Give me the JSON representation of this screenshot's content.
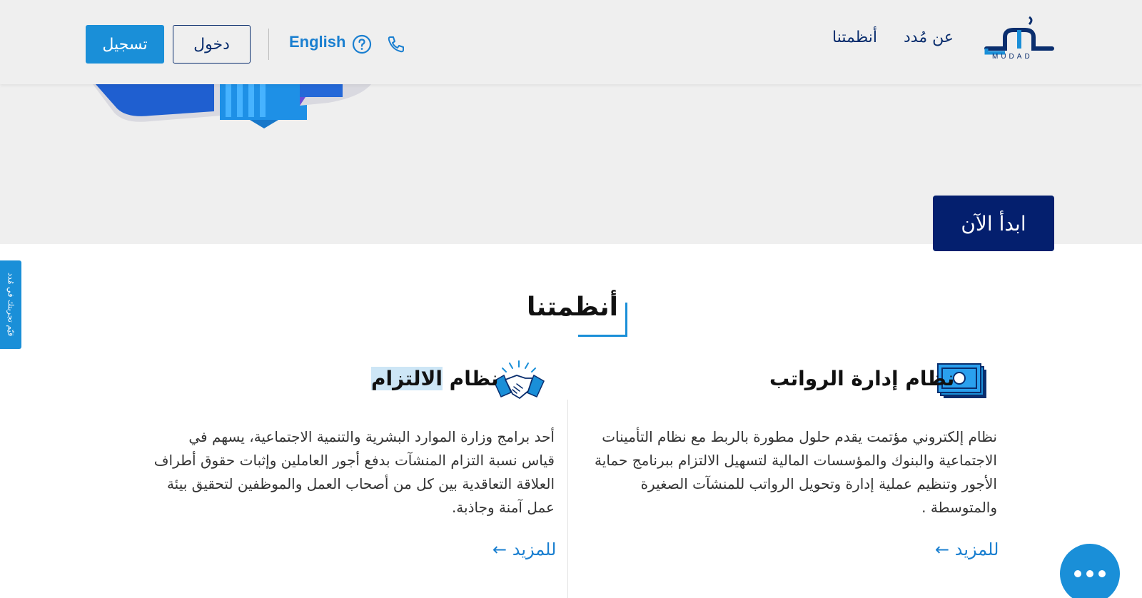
{
  "header": {
    "logo_text": "MUDAD",
    "nav": {
      "about": "عن مُدد",
      "systems": "أنظمتنا"
    },
    "register_label": "تسجيل",
    "login_label": "دخول",
    "language_label": "English"
  },
  "hero": {
    "start_label": "ابدأ الآن"
  },
  "side_tab": {
    "label": "قيّم تجربتك في مُدد"
  },
  "section": {
    "title": "أنظمتنا"
  },
  "cards": {
    "payroll": {
      "title": "نظام إدارة الرواتب",
      "description": "نظام إلكتروني مؤتمت يقدم حلول مطورة بالربط مع نظام التأمينات الاجتماعية والبنوك والمؤسسات المالية لتسهيل الالتزام ببرنامج حماية الأجور وتنظيم عملية إدارة وتحويل الرواتب للمنشآت الصغيرة والمتوسطة .",
      "more_label": "للمزيد ←"
    },
    "compliance": {
      "title_prefix": "نظام ",
      "title_highlight": "الالتزام",
      "description": "أحد برامج وزارة الموارد البشرية والتنمية الاجتماعية، يسهم في قياس نسبة التزام المنشآت بدفع أجور العاملين وإثبات حقوق أطراف العلاقة التعاقدية بين كل من أصحاب العمل والموظفين لتحقيق بيئة عمل آمنة وجاذبة.",
      "more_label": "للمزيد ←"
    }
  },
  "colors": {
    "navy": "#041f6e",
    "blue": "#1a8fd8",
    "header_bg": "#efefef"
  }
}
